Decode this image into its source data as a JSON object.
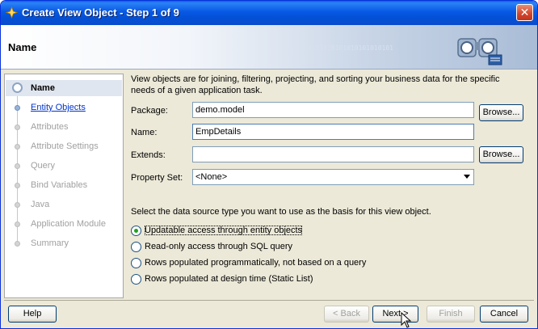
{
  "window": {
    "title": "Create View Object - Step 1 of 9",
    "close_glyph": "✕"
  },
  "header": {
    "title": "Name",
    "binary_text": "0101010101010101010101"
  },
  "nav": {
    "items": [
      {
        "label": "Name",
        "state": "current"
      },
      {
        "label": "Entity Objects",
        "state": "link"
      },
      {
        "label": "Attributes",
        "state": "disabled"
      },
      {
        "label": "Attribute Settings",
        "state": "disabled"
      },
      {
        "label": "Query",
        "state": "disabled"
      },
      {
        "label": "Bind Variables",
        "state": "disabled"
      },
      {
        "label": "Java",
        "state": "disabled"
      },
      {
        "label": "Application Module",
        "state": "disabled"
      },
      {
        "label": "Summary",
        "state": "disabled"
      }
    ]
  },
  "content": {
    "description": "View objects are for joining, filtering, projecting, and sorting your business data for the specific needs of a given application task.",
    "package": {
      "label": "Package:",
      "value": "demo.model"
    },
    "name": {
      "label": "Name:",
      "value": "EmpDetails"
    },
    "extends": {
      "label": "Extends:",
      "value": ""
    },
    "property_set": {
      "label": "Property Set:",
      "value": "<None>"
    },
    "browse_label": "Browse...",
    "datasource_prompt": "Select the data source type you want to use as the basis for this view object.",
    "radios": [
      {
        "label": "Updatable access through entity objects",
        "checked": true
      },
      {
        "label": "Read-only access through SQL query",
        "checked": false
      },
      {
        "label": "Rows populated programmatically, not based on a query",
        "checked": false
      },
      {
        "label": "Rows populated at design time (Static List)",
        "checked": false
      }
    ]
  },
  "footer": {
    "help": "Help",
    "back": "< Back",
    "next": "Next >",
    "finish": "Finish",
    "cancel": "Cancel"
  },
  "colors": {
    "titlebar": "#0a5fe4",
    "link": "#0033cc",
    "disabled": "#a0a0a0",
    "radio_check": "#21a121"
  },
  "icons": [
    "wizard-icon",
    "close-icon",
    "binoculars-icon",
    "radio-icon",
    "dropdown-arrow-icon"
  ]
}
